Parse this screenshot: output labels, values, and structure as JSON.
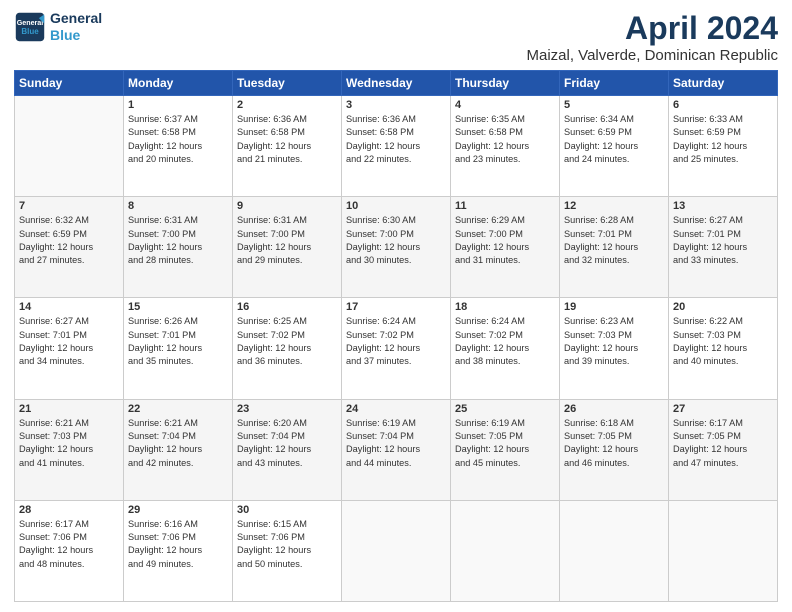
{
  "header": {
    "logo_line1": "General",
    "logo_line2": "Blue",
    "title": "April 2024",
    "subtitle": "Maizal, Valverde, Dominican Republic"
  },
  "weekdays": [
    "Sunday",
    "Monday",
    "Tuesday",
    "Wednesday",
    "Thursday",
    "Friday",
    "Saturday"
  ],
  "weeks": [
    [
      {
        "day": "",
        "info": ""
      },
      {
        "day": "1",
        "info": "Sunrise: 6:37 AM\nSunset: 6:58 PM\nDaylight: 12 hours\nand 20 minutes."
      },
      {
        "day": "2",
        "info": "Sunrise: 6:36 AM\nSunset: 6:58 PM\nDaylight: 12 hours\nand 21 minutes."
      },
      {
        "day": "3",
        "info": "Sunrise: 6:36 AM\nSunset: 6:58 PM\nDaylight: 12 hours\nand 22 minutes."
      },
      {
        "day": "4",
        "info": "Sunrise: 6:35 AM\nSunset: 6:58 PM\nDaylight: 12 hours\nand 23 minutes."
      },
      {
        "day": "5",
        "info": "Sunrise: 6:34 AM\nSunset: 6:59 PM\nDaylight: 12 hours\nand 24 minutes."
      },
      {
        "day": "6",
        "info": "Sunrise: 6:33 AM\nSunset: 6:59 PM\nDaylight: 12 hours\nand 25 minutes."
      }
    ],
    [
      {
        "day": "7",
        "info": "Sunrise: 6:32 AM\nSunset: 6:59 PM\nDaylight: 12 hours\nand 27 minutes."
      },
      {
        "day": "8",
        "info": "Sunrise: 6:31 AM\nSunset: 7:00 PM\nDaylight: 12 hours\nand 28 minutes."
      },
      {
        "day": "9",
        "info": "Sunrise: 6:31 AM\nSunset: 7:00 PM\nDaylight: 12 hours\nand 29 minutes."
      },
      {
        "day": "10",
        "info": "Sunrise: 6:30 AM\nSunset: 7:00 PM\nDaylight: 12 hours\nand 30 minutes."
      },
      {
        "day": "11",
        "info": "Sunrise: 6:29 AM\nSunset: 7:00 PM\nDaylight: 12 hours\nand 31 minutes."
      },
      {
        "day": "12",
        "info": "Sunrise: 6:28 AM\nSunset: 7:01 PM\nDaylight: 12 hours\nand 32 minutes."
      },
      {
        "day": "13",
        "info": "Sunrise: 6:27 AM\nSunset: 7:01 PM\nDaylight: 12 hours\nand 33 minutes."
      }
    ],
    [
      {
        "day": "14",
        "info": "Sunrise: 6:27 AM\nSunset: 7:01 PM\nDaylight: 12 hours\nand 34 minutes."
      },
      {
        "day": "15",
        "info": "Sunrise: 6:26 AM\nSunset: 7:01 PM\nDaylight: 12 hours\nand 35 minutes."
      },
      {
        "day": "16",
        "info": "Sunrise: 6:25 AM\nSunset: 7:02 PM\nDaylight: 12 hours\nand 36 minutes."
      },
      {
        "day": "17",
        "info": "Sunrise: 6:24 AM\nSunset: 7:02 PM\nDaylight: 12 hours\nand 37 minutes."
      },
      {
        "day": "18",
        "info": "Sunrise: 6:24 AM\nSunset: 7:02 PM\nDaylight: 12 hours\nand 38 minutes."
      },
      {
        "day": "19",
        "info": "Sunrise: 6:23 AM\nSunset: 7:03 PM\nDaylight: 12 hours\nand 39 minutes."
      },
      {
        "day": "20",
        "info": "Sunrise: 6:22 AM\nSunset: 7:03 PM\nDaylight: 12 hours\nand 40 minutes."
      }
    ],
    [
      {
        "day": "21",
        "info": "Sunrise: 6:21 AM\nSunset: 7:03 PM\nDaylight: 12 hours\nand 41 minutes."
      },
      {
        "day": "22",
        "info": "Sunrise: 6:21 AM\nSunset: 7:04 PM\nDaylight: 12 hours\nand 42 minutes."
      },
      {
        "day": "23",
        "info": "Sunrise: 6:20 AM\nSunset: 7:04 PM\nDaylight: 12 hours\nand 43 minutes."
      },
      {
        "day": "24",
        "info": "Sunrise: 6:19 AM\nSunset: 7:04 PM\nDaylight: 12 hours\nand 44 minutes."
      },
      {
        "day": "25",
        "info": "Sunrise: 6:19 AM\nSunset: 7:05 PM\nDaylight: 12 hours\nand 45 minutes."
      },
      {
        "day": "26",
        "info": "Sunrise: 6:18 AM\nSunset: 7:05 PM\nDaylight: 12 hours\nand 46 minutes."
      },
      {
        "day": "27",
        "info": "Sunrise: 6:17 AM\nSunset: 7:05 PM\nDaylight: 12 hours\nand 47 minutes."
      }
    ],
    [
      {
        "day": "28",
        "info": "Sunrise: 6:17 AM\nSunset: 7:06 PM\nDaylight: 12 hours\nand 48 minutes."
      },
      {
        "day": "29",
        "info": "Sunrise: 6:16 AM\nSunset: 7:06 PM\nDaylight: 12 hours\nand 49 minutes."
      },
      {
        "day": "30",
        "info": "Sunrise: 6:15 AM\nSunset: 7:06 PM\nDaylight: 12 hours\nand 50 minutes."
      },
      {
        "day": "",
        "info": ""
      },
      {
        "day": "",
        "info": ""
      },
      {
        "day": "",
        "info": ""
      },
      {
        "day": "",
        "info": ""
      }
    ]
  ]
}
